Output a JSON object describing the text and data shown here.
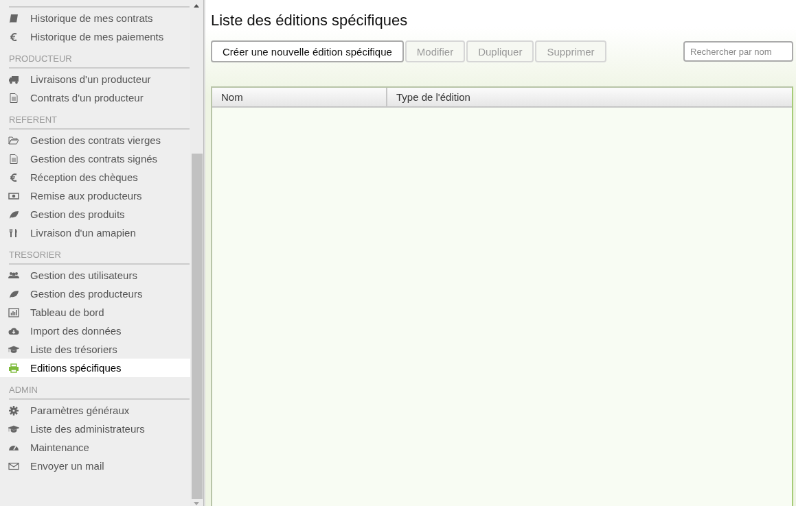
{
  "sidebar": {
    "sections": [
      {
        "items": [
          {
            "label": "Historique de mes contrats",
            "selected": false
          },
          {
            "label": "Historique de mes paiements",
            "selected": false
          }
        ]
      },
      {
        "heading": "PRODUCTEUR",
        "items": [
          {
            "label": "Livraisons d'un producteur",
            "selected": false
          },
          {
            "label": "Contrats d'un producteur",
            "selected": false
          }
        ]
      },
      {
        "heading": "REFERENT",
        "items": [
          {
            "label": "Gestion des contrats vierges",
            "selected": false
          },
          {
            "label": "Gestion des contrats signés",
            "selected": false
          },
          {
            "label": "Réception des chèques",
            "selected": false
          },
          {
            "label": "Remise aux producteurs",
            "selected": false
          },
          {
            "label": "Gestion des produits",
            "selected": false
          },
          {
            "label": "Livraison d'un amapien",
            "selected": false
          }
        ]
      },
      {
        "heading": "TRESORIER",
        "items": [
          {
            "label": "Gestion des utilisateurs",
            "selected": false
          },
          {
            "label": "Gestion des producteurs",
            "selected": false
          },
          {
            "label": "Tableau de bord",
            "selected": false
          },
          {
            "label": "Import des données",
            "selected": false
          },
          {
            "label": "Liste des trésoriers",
            "selected": false
          },
          {
            "label": "Editions spécifiques",
            "selected": true
          }
        ]
      },
      {
        "heading": "ADMIN",
        "items": [
          {
            "label": "Paramètres généraux",
            "selected": false
          },
          {
            "label": "Liste des administrateurs",
            "selected": false
          },
          {
            "label": "Maintenance",
            "selected": false
          },
          {
            "label": "Envoyer un mail",
            "selected": false
          }
        ]
      }
    ]
  },
  "page": {
    "title": "Liste des éditions spécifiques",
    "buttons": [
      {
        "label": "Créer une nouvelle édition spécifique",
        "disabled": false
      },
      {
        "label": "Modifier",
        "disabled": true
      },
      {
        "label": "Dupliquer",
        "disabled": true
      },
      {
        "label": "Supprimer",
        "disabled": true
      }
    ],
    "search": {
      "placeholder": "Rechercher par nom"
    },
    "table": {
      "columns": [
        "Nom",
        "Type de l'édition"
      ]
    }
  }
}
